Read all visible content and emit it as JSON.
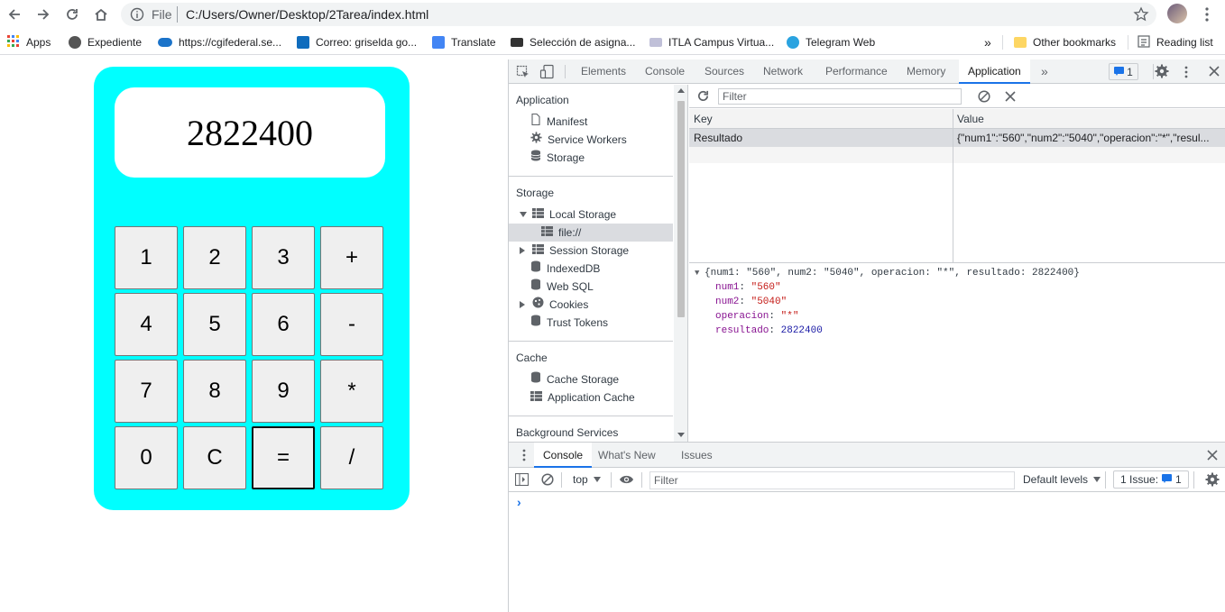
{
  "browser": {
    "address_scheme": "File",
    "address_url": "C:/Users/Owner/Desktop/2Tarea/index.html"
  },
  "bookmarks": {
    "items": [
      "Apps",
      "Expediente",
      "https://cgifederal.se...",
      "Correo: griselda go...",
      "Translate",
      "Selección de asigna...",
      "ITLA Campus Virtua...",
      "Telegram Web"
    ],
    "overflow": "»",
    "other": "Other bookmarks",
    "reading_list": "Reading list"
  },
  "calculator": {
    "display": "2822400",
    "keys": [
      [
        "1",
        "2",
        "3",
        "+"
      ],
      [
        "4",
        "5",
        "6",
        "-"
      ],
      [
        "7",
        "8",
        "9",
        "*"
      ],
      [
        "0",
        "C",
        "=",
        "/"
      ]
    ],
    "color": "#00ffff"
  },
  "devtools": {
    "tabs": [
      "Elements",
      "Console",
      "Sources",
      "Network",
      "Performance",
      "Memory",
      "Application"
    ],
    "more": "»",
    "issues_badge": "1",
    "sidebar": {
      "application_header": "Application",
      "application_items": [
        "Manifest",
        "Service Workers",
        "Storage"
      ],
      "storage_header": "Storage",
      "storage_items": [
        "Local Storage",
        "file://",
        "Session Storage",
        "IndexedDB",
        "Web SQL",
        "Cookies",
        "Trust Tokens"
      ],
      "cache_header": "Cache",
      "cache_items": [
        "Cache Storage",
        "Application Cache"
      ],
      "background_header": "Background Services"
    },
    "storage": {
      "filter_placeholder": "Filter",
      "col_key": "Key",
      "col_value": "Value",
      "row_key": "Resultado",
      "row_value": "{\"num1\":\"560\",\"num2\":\"5040\",\"operacion\":\"*\",\"resul...",
      "preview_summary": "{num1: \"560\", num2: \"5040\", operacion: \"*\", resultado: 2822400}",
      "preview_props": [
        {
          "k": "num1",
          "v": "\"560\""
        },
        {
          "k": "num2",
          "v": "\"5040\""
        },
        {
          "k": "operacion",
          "v": "\"*\""
        },
        {
          "k": "resultado",
          "v": "2822400"
        }
      ]
    },
    "drawer": {
      "tabs": [
        "Console",
        "What's New",
        "Issues"
      ],
      "context": "top",
      "filter_placeholder": "Filter",
      "levels": "Default levels",
      "issues_label": "1 Issue:",
      "issues_count": "1",
      "prompt": "›"
    }
  }
}
